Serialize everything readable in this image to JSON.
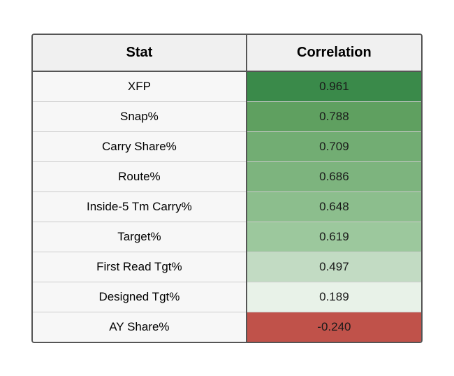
{
  "table": {
    "headers": {
      "stat": "Stat",
      "correlation": "Correlation"
    },
    "rows": [
      {
        "stat": "XFP",
        "correlation": "0.961",
        "colorClass": "corr-0"
      },
      {
        "stat": "Snap%",
        "correlation": "0.788",
        "colorClass": "corr-1"
      },
      {
        "stat": "Carry Share%",
        "correlation": "0.709",
        "colorClass": "corr-2"
      },
      {
        "stat": "Route%",
        "correlation": "0.686",
        "colorClass": "corr-3"
      },
      {
        "stat": "Inside-5 Tm Carry%",
        "correlation": "0.648",
        "colorClass": "corr-4"
      },
      {
        "stat": "Target%",
        "correlation": "0.619",
        "colorClass": "corr-5"
      },
      {
        "stat": "First Read Tgt%",
        "correlation": "0.497",
        "colorClass": "corr-6"
      },
      {
        "stat": "Designed Tgt%",
        "correlation": "0.189",
        "colorClass": "corr-7"
      },
      {
        "stat": "AY Share%",
        "correlation": "-0.240",
        "colorClass": "corr-neg"
      }
    ]
  }
}
